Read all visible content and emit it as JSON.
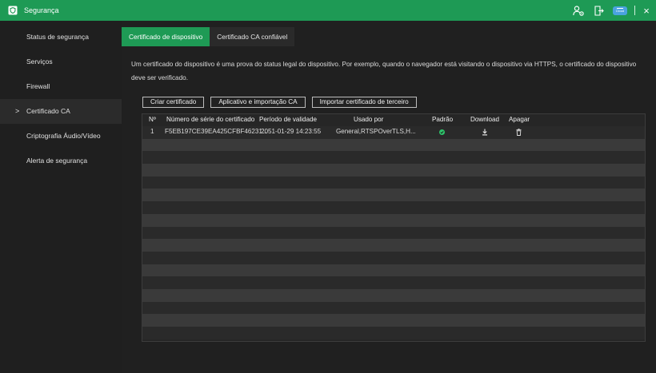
{
  "window": {
    "title": "Segurança",
    "cloud_badge": "Cloud",
    "close_label": "×"
  },
  "sidebar": {
    "items": [
      {
        "label": "Status de segurança"
      },
      {
        "label": "Serviços"
      },
      {
        "label": "Firewall"
      },
      {
        "label": "Certificado CA",
        "active": true
      },
      {
        "label": "Criptografia Áudio/Vídeo"
      },
      {
        "label": "Alerta de segurança"
      }
    ],
    "active_marker": ">"
  },
  "tabs": [
    {
      "label": "Certificado de dispositivo",
      "active": true
    },
    {
      "label": "Certificado CA confiável",
      "active": false
    }
  ],
  "description": "Um certificado do dispositivo é uma prova do status legal do dispositivo. Por exemplo, quando o navegador está visitando o dispositivo via HTTPS, o certificado do dispositivo deve ser verificado.",
  "actions": {
    "create": "Criar certificado",
    "apply_import": "Aplicativo e importação CA",
    "import_third": "Importar certificado de terceiro"
  },
  "table": {
    "headers": {
      "no": "Nº",
      "serial": "Número de série do certificado",
      "validity": "Período de validade",
      "used_by": "Usado por",
      "default": "Padrão",
      "download": "Download",
      "delete": "Apagar"
    },
    "rows": [
      {
        "no": "1",
        "serial": "F5EB197CE39EA425CFBF46231...",
        "validity": "2051-01-29 14:23:55",
        "used_by": "General,RTSPOverTLS,H...",
        "default": true
      }
    ]
  },
  "colors": {
    "accent": "#1e9a55",
    "default_status": "#2ec46b"
  },
  "icons": {
    "title": "shield-icon",
    "user": "user-settings-icon",
    "logout": "logout-icon",
    "cloud": "cloud-icon",
    "download": "download-icon",
    "delete": "trash-icon",
    "default": "check-circle-icon"
  }
}
